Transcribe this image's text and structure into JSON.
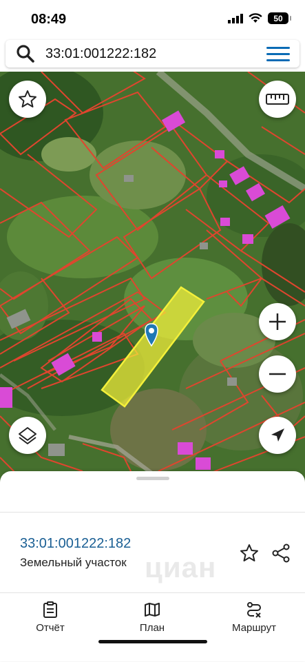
{
  "status": {
    "time": "08:49",
    "battery": "50"
  },
  "search": {
    "query": "33:01:001222:182",
    "icon": "search-icon",
    "menu_icon": "hamburger-menu-icon"
  },
  "map": {
    "highlight_color": "#f4f03a",
    "parcel_border_color": "#e0452e",
    "building_color": "#d94bd6",
    "controls": [
      "star-icon",
      "ruler-icon",
      "layers-icon",
      "zoom-in-icon",
      "zoom-out-icon",
      "location-arrow-icon"
    ]
  },
  "parcel": {
    "cadastral_number": "33:01:001222:182",
    "type": "Земельный участок",
    "watermark": "циан"
  },
  "tabs": [
    {
      "label": "Отчёт",
      "icon": "report-clipboard-icon"
    },
    {
      "label": "План",
      "icon": "map-plan-icon"
    },
    {
      "label": "Маршрут",
      "icon": "route-icon"
    }
  ]
}
